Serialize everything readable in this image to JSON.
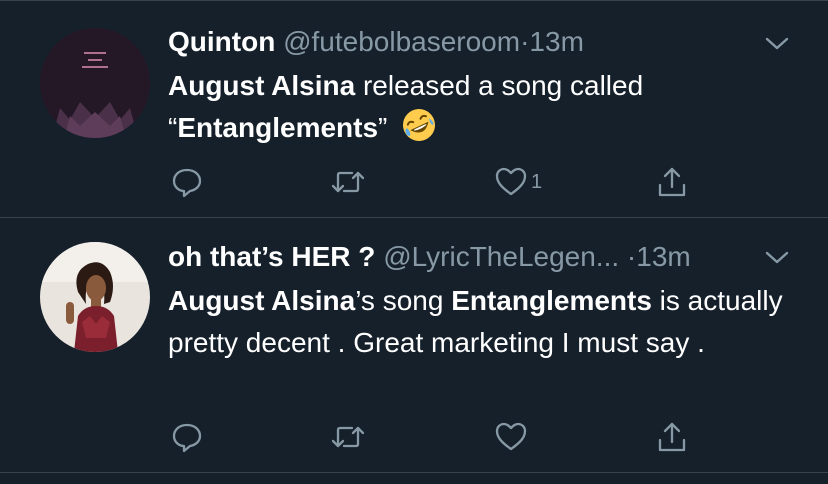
{
  "tweets": [
    {
      "name": "Quinton",
      "handle": "@futebolbaseroom",
      "separator": "·",
      "time": "13m",
      "body": [
        {
          "text": "August Alsina",
          "bold": true
        },
        {
          "text": " released a song called",
          "bold": false
        },
        {
          "text": "“",
          "bold": false
        },
        {
          "text": "Entanglements",
          "bold": true
        },
        {
          "text": "”",
          "bold": false
        }
      ],
      "emoji": "rolling-on-floor-laughing-emoji",
      "like_count": "1"
    },
    {
      "name": "oh that’s HER ?",
      "handle": "@LyricTheLegen...",
      "separator": "·",
      "time": "13m",
      "body": [
        {
          "text": "August Alsina",
          "bold": true
        },
        {
          "text": "’s song ",
          "bold": false
        },
        {
          "text": "Entanglements",
          "bold": true
        },
        {
          "text": " is actually pretty decent . Great marketing I must say .",
          "bold": false
        }
      ],
      "like_count": ""
    }
  ],
  "icons": {
    "reply": "reply-icon",
    "retweet": "retweet-icon",
    "like": "heart-icon",
    "share": "share-icon",
    "menu": "chevron-down-icon"
  },
  "colors": {
    "background": "#15202b",
    "secondary_text": "#8899a6",
    "divider": "#38444d"
  }
}
